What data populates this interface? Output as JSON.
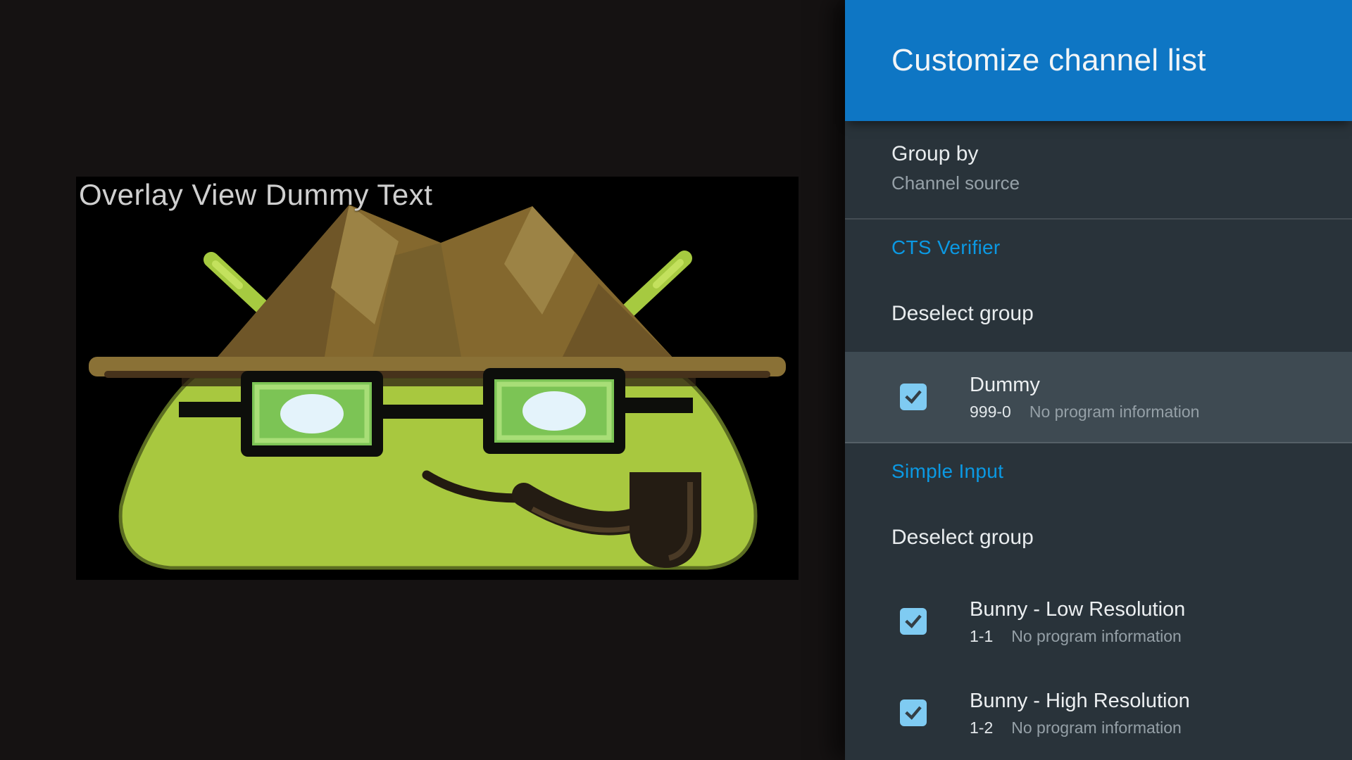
{
  "overlay": {
    "text": "Overlay View Dummy Text",
    "image": "android-detective-mascot"
  },
  "panel": {
    "title": "Customize channel list",
    "group_by": {
      "label": "Group by",
      "value": "Channel source"
    },
    "sections": [
      {
        "name": "CTS Verifier",
        "deselect_label": "Deselect group",
        "channels": [
          {
            "title": "Dummy",
            "number": "999-0",
            "info": "No program information",
            "checked": true,
            "focused": true
          }
        ]
      },
      {
        "name": "Simple Input",
        "deselect_label": "Deselect group",
        "channels": [
          {
            "title": "Bunny - Low Resolution",
            "number": "1-1",
            "info": "No program information",
            "checked": true,
            "focused": false
          },
          {
            "title": "Bunny - High Resolution",
            "number": "1-2",
            "info": "No program information",
            "checked": true,
            "focused": false
          }
        ]
      }
    ]
  },
  "colors": {
    "header_blue": "#0e76c4",
    "section_label_blue": "#0b99e3",
    "checkbox_blue": "#7fcbf2",
    "panel_bg": "#29333a",
    "focused_row_bg": "#3e4a52",
    "overlay_bg": "#000000"
  }
}
